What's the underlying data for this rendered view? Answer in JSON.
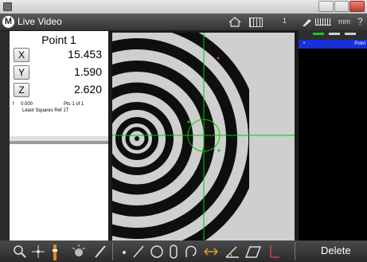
{
  "app": {
    "title": "Live Video",
    "logo_letter": "M",
    "units": "mm",
    "count": "1",
    "help": "?"
  },
  "dro": {
    "feature_title": "Point 1",
    "axes": [
      {
        "label": "X",
        "value": "15.453"
      },
      {
        "label": "Y",
        "value": "1.590"
      },
      {
        "label": "Z",
        "value": "2.620"
      }
    ],
    "info": {
      "f_label": "f",
      "f_value": "0.000",
      "pts": "Pts 1 of 1",
      "method": "Least Squares",
      "ref": "Ref 1T"
    }
  },
  "feature_list": {
    "selected_item": "Point"
  },
  "toolbar": {
    "delete_label": "Delete"
  },
  "colors": {
    "crosshair": "#00c800",
    "selection": "#1830d8"
  }
}
